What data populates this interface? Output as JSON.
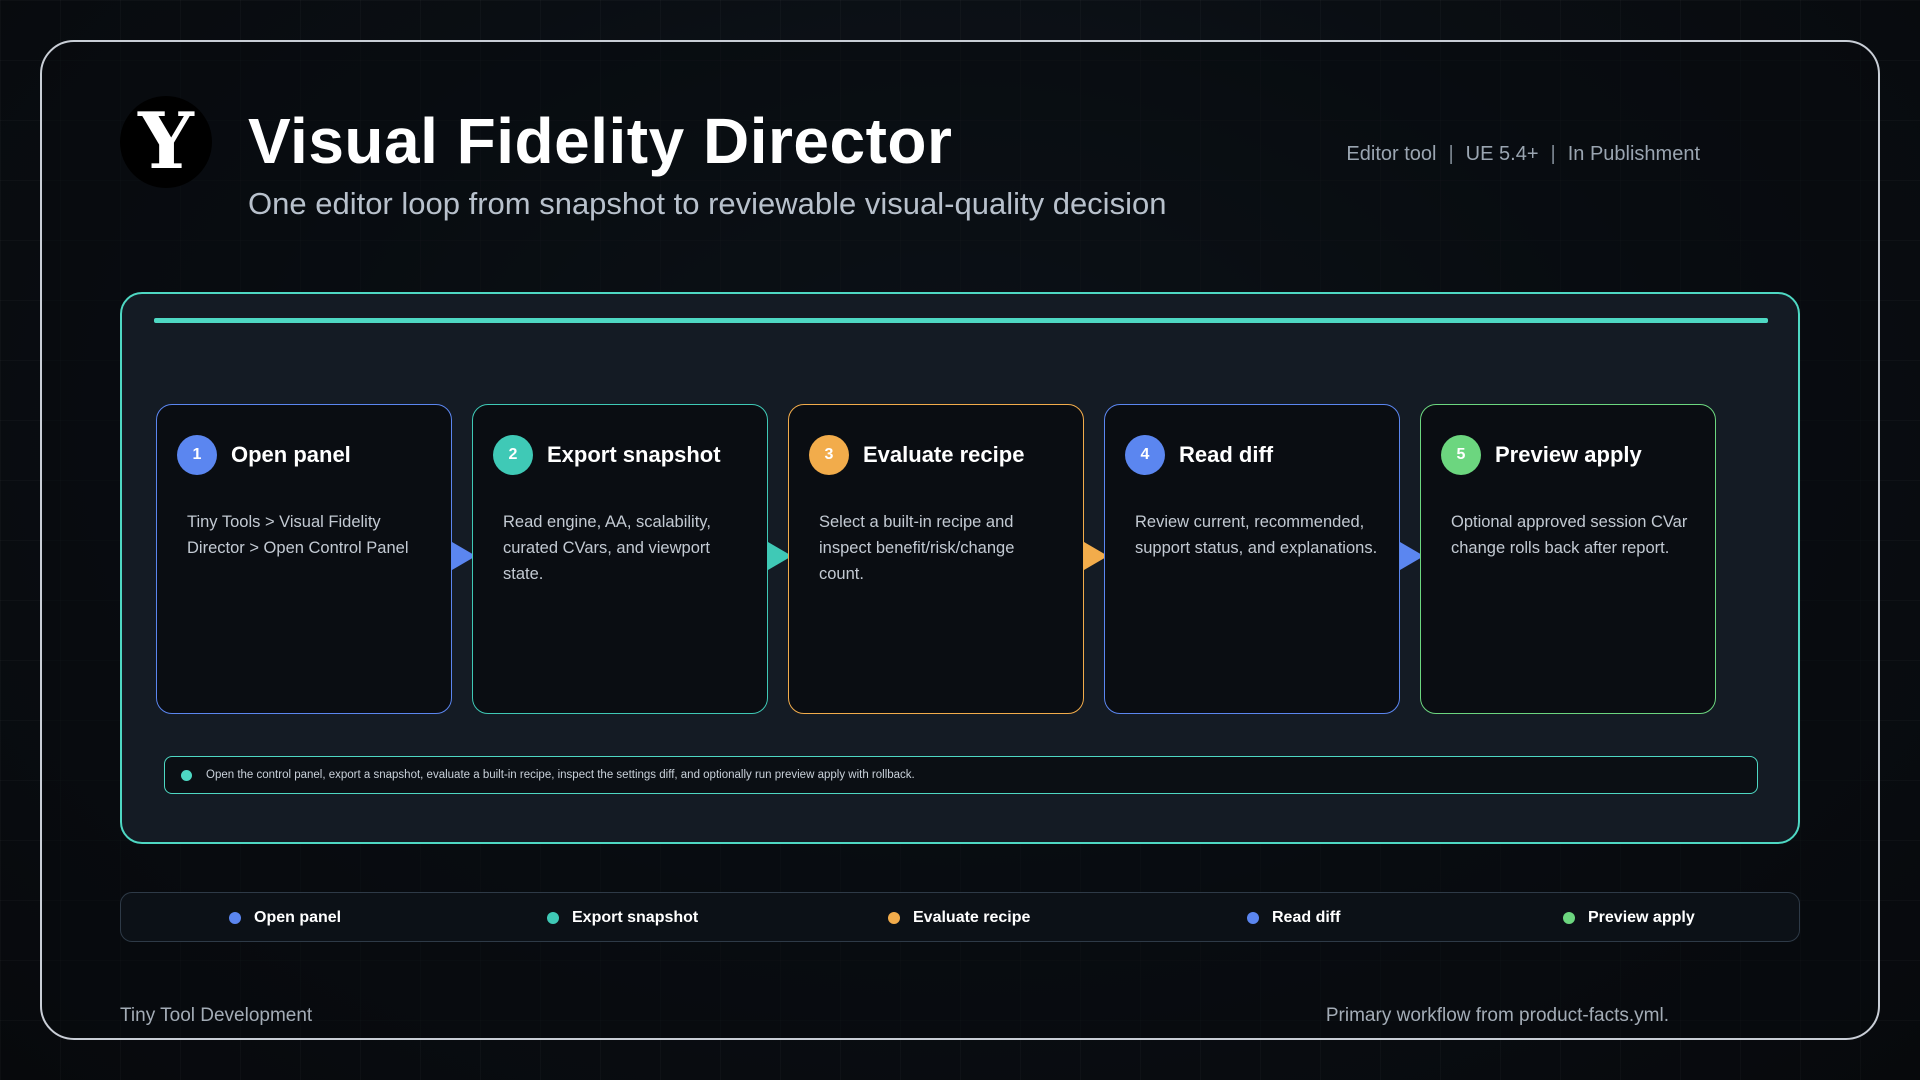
{
  "header": {
    "logo_letter": "Y",
    "title": "Visual Fidelity Director",
    "subtitle": "One editor loop from snapshot to reviewable visual-quality decision",
    "meta": [
      "Editor tool",
      "UE 5.4+",
      "In Publishment"
    ],
    "meta_separator": "|"
  },
  "steps": [
    {
      "number": "1",
      "title": "Open panel",
      "body": "Tiny Tools > Visual Fidelity Director > Open Control Panel",
      "color": "#5b86f0"
    },
    {
      "number": "2",
      "title": "Export snapshot",
      "body": "Read engine, AA, scalability, curated CVars, and viewport state.",
      "color": "#3fc9b6"
    },
    {
      "number": "3",
      "title": "Evaluate recipe",
      "body": "Select a built-in recipe and inspect benefit/risk/change count.",
      "color": "#f2ac4b"
    },
    {
      "number": "4",
      "title": "Read diff",
      "body": "Review current, recommended, support status, and explanations.",
      "color": "#5b86f0"
    },
    {
      "number": "5",
      "title": "Preview apply",
      "body": "Optional approved session CVar change rolls back after report.",
      "color": "#6cd67f"
    }
  ],
  "note": "Open the control panel, export a snapshot, evaluate a built-in recipe, inspect the settings diff, and optionally run preview apply with rollback.",
  "legend": [
    {
      "label": "Open panel",
      "color": "#5b86f0"
    },
    {
      "label": "Export snapshot",
      "color": "#3fc9b6"
    },
    {
      "label": "Evaluate recipe",
      "color": "#f2ac4b"
    },
    {
      "label": "Read diff",
      "color": "#5b86f0"
    },
    {
      "label": "Preview apply",
      "color": "#6cd67f"
    }
  ],
  "footer": {
    "left": "Tiny Tool Development",
    "right": "Primary workflow from product-facts.yml."
  },
  "colors": {
    "accent": "#4ed8c3",
    "frame": "#c9ced6"
  }
}
